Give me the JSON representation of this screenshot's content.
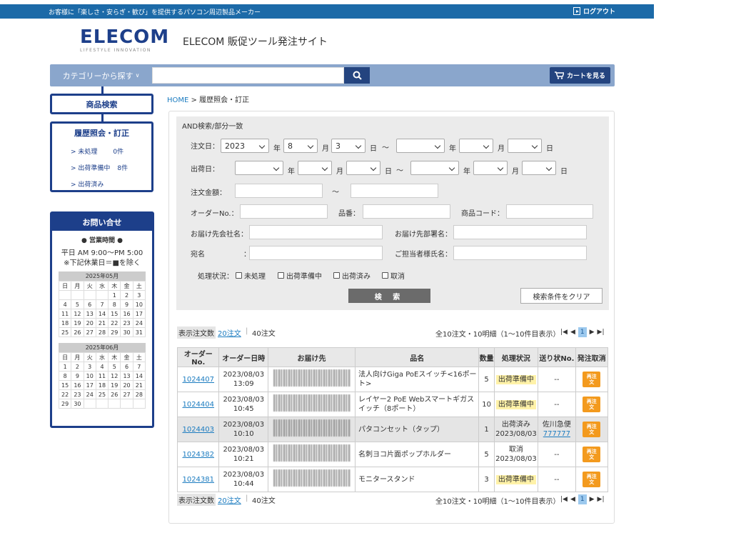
{
  "topbar": {
    "tagline": "お客様に「楽しさ・安らぎ・歓び」を提供するパソコン周辺製品メーカー",
    "logout": "ログアウト"
  },
  "brand": {
    "logo": "ELECOM",
    "logo_sub": "LIFESTYLE INNOVATION",
    "site_title": "ELECOM 販促ツール発注サイト"
  },
  "search": {
    "category_label": "カテゴリーから探す",
    "placeholder": "",
    "cart_label": "カートを見る"
  },
  "sidebar": {
    "product_search": "商品検索",
    "history_title": "履歴照会・訂正",
    "items": [
      {
        "label": "> 未処理",
        "count": "0件"
      },
      {
        "label": "> 出荷準備中",
        "count": "8件"
      },
      {
        "label": "> 出荷済み",
        "count": ""
      }
    ]
  },
  "contact": {
    "title": "お問い合せ",
    "hours_title": "● 営業時間 ●",
    "hours_line1": "平日 AM 9:00〜PM 5:00",
    "hours_line2": "※下記休業日＝■を除く",
    "weekdays": [
      "日",
      "月",
      "火",
      "水",
      "木",
      "金",
      "土"
    ],
    "calendars": [
      {
        "caption": "2025年05月",
        "weeks": [
          [
            "",
            "",
            "",
            "",
            "1",
            "2",
            "3"
          ],
          [
            "4",
            "5",
            "6",
            "7",
            "8",
            "9",
            "10"
          ],
          [
            "11",
            "12",
            "13",
            "14",
            "15",
            "16",
            "17"
          ],
          [
            "18",
            "19",
            "20",
            "21",
            "22",
            "23",
            "24"
          ],
          [
            "25",
            "26",
            "27",
            "28",
            "29",
            "30",
            "31"
          ]
        ]
      },
      {
        "caption": "2025年06月",
        "weeks": [
          [
            "1",
            "2",
            "3",
            "4",
            "5",
            "6",
            "7"
          ],
          [
            "8",
            "9",
            "10",
            "11",
            "12",
            "13",
            "14"
          ],
          [
            "15",
            "16",
            "17",
            "18",
            "19",
            "20",
            "21"
          ],
          [
            "22",
            "23",
            "24",
            "25",
            "26",
            "27",
            "28"
          ],
          [
            "29",
            "30",
            "",
            "",
            "",
            "",
            ""
          ]
        ]
      }
    ]
  },
  "breadcrumb": {
    "home": "HOME",
    "sep": " > ",
    "current": "履歴照会・訂正"
  },
  "filter": {
    "title": "AND検索/部分一致",
    "order_date": "注文日：",
    "ship_date": "出荷日：",
    "amount": "注文金額：",
    "order_no": "オーダーNo.：",
    "item_no": "品番：",
    "product_code": "商品コード：",
    "dest_company": "お届け先会社名：",
    "dest_dept": "お届け先部署名：",
    "addressee": "宛名",
    "addressee_colon": "：",
    "contact_name": "ご担当者様氏名：",
    "status_label": "処理状況：",
    "tilde": "〜",
    "year": "年",
    "month": "月",
    "day": "日",
    "order_from": {
      "year": "2023",
      "month": "8",
      "day": "3"
    },
    "statuses": [
      "未処理",
      "出荷準備中",
      "出荷済み",
      "取消"
    ],
    "search_btn": "検 索",
    "clear_btn": "検索条件をクリア"
  },
  "pager": {
    "display_label": "表示注文数",
    "per_page_20": "20注文",
    "separator": "|",
    "per_page_40": "40注文",
    "summary": "全10注文・10明細（1〜10件目表示）",
    "current_page": "1"
  },
  "table": {
    "headers": [
      "オーダーNo.",
      "オーダー日時",
      "お届け先",
      "品名",
      "数量",
      "処理状況",
      "送り状No.",
      "発注取消"
    ],
    "reorder_label": "再注文",
    "rows": [
      {
        "order_no": "1024407",
        "date": "2023/08/03",
        "time": "13:09",
        "item": "法人向けGiga PoEスイッチ<16ポート>",
        "qty": "5",
        "status": "出荷準備中",
        "status_date": "",
        "ship_no": "--",
        "ship_link": "",
        "grey": false
      },
      {
        "order_no": "1024404",
        "date": "2023/08/03",
        "time": "10:45",
        "item": "レイヤー2 PoE Webスマートギガスイッチ（8ポート）",
        "qty": "10",
        "status": "出荷準備中",
        "status_date": "",
        "ship_no": "--",
        "ship_link": "",
        "grey": false
      },
      {
        "order_no": "1024403",
        "date": "2023/08/03",
        "time": "10:10",
        "item": "パタコンセット（タップ）",
        "qty": "1",
        "status": "出荷済み",
        "status_date": "2023/08/03",
        "ship_no": "佐川急便",
        "ship_link": "777777",
        "grey": true
      },
      {
        "order_no": "1024382",
        "date": "2023/08/03",
        "time": "10:21",
        "item": "名刺ヨコ片面ポップホルダー",
        "qty": "5",
        "status": "取消",
        "status_date": "2023/08/03",
        "ship_no": "--",
        "ship_link": "",
        "grey": false
      },
      {
        "order_no": "1024381",
        "date": "2023/08/03",
        "time": "10:44",
        "item": "モニタースタンド",
        "qty": "3",
        "status": "出荷準備中",
        "status_date": "",
        "ship_no": "--",
        "ship_link": "",
        "grey": false
      }
    ]
  }
}
